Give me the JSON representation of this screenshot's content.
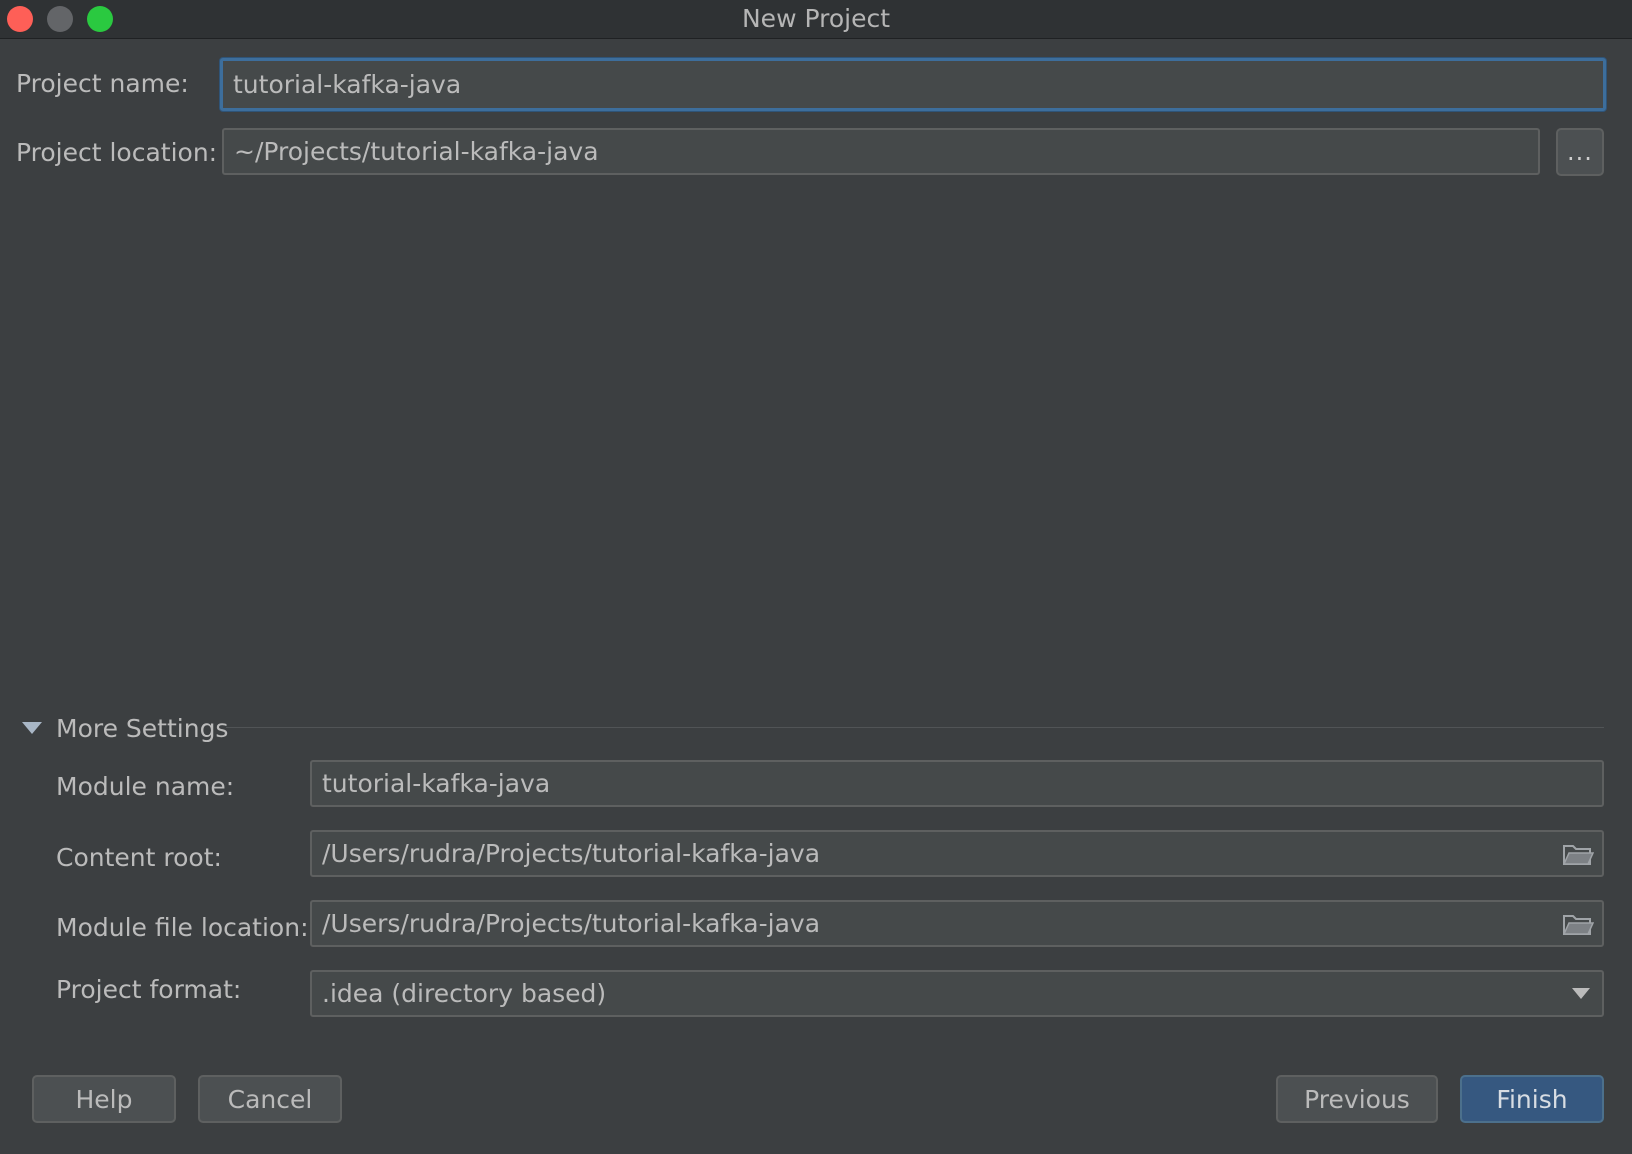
{
  "window": {
    "title": "New Project"
  },
  "project": {
    "name_label": "Project name:",
    "name_value": "tutorial-kafka-java",
    "location_label": "Project location:",
    "location_value": "~/Projects/tutorial-kafka-java",
    "browse_label": "..."
  },
  "more_settings": {
    "title": "More Settings",
    "module_name_label": "Module name:",
    "module_name_value": "tutorial-kafka-java",
    "content_root_label": "Content root:",
    "content_root_value": "/Users/rudra/Projects/tutorial-kafka-java",
    "module_file_label": "Module file location:",
    "module_file_value": "/Users/rudra/Projects/tutorial-kafka-java",
    "format_label": "Project format:",
    "format_value": ".idea (directory based)"
  },
  "buttons": {
    "help": "Help",
    "cancel": "Cancel",
    "previous": "Previous",
    "finish": "Finish"
  },
  "colors": {
    "background": "#3c3f41",
    "field": "#45494a",
    "focus_border": "#3d6e9c",
    "primary_button": "#365880",
    "close": "#fe5f57",
    "maximize": "#2ac940"
  }
}
